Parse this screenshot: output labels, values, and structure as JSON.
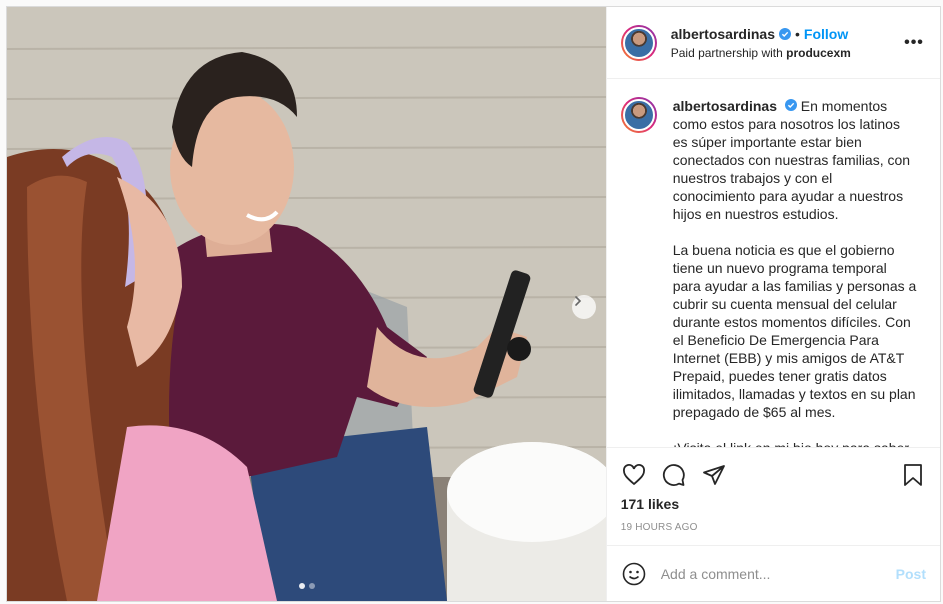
{
  "post": {
    "username": "albertosardinas",
    "follow_label": "Follow",
    "separator": "•",
    "partnership_prefix": "Paid partnership with",
    "partner": "producexm",
    "more_label": "•••"
  },
  "caption": {
    "username": "albertosardinas",
    "paragraph1": "En momentos como estos para nosotros los latinos es súper importante estar bien conectados con nuestras familias, con nuestros trabajos y con el conocimiento para ayudar a nuestros hijos en nuestros estudios.",
    "paragraph2": "La buena noticia es que el gobierno tiene un nuevo programa temporal para ayudar a las familias y personas a cubrir su cuenta mensual del celular durante estos momentos difíciles. Con el Beneficio De Emergencia Para Internet (EBB) y mis amigos de AT&T Prepaid, puedes tener gratis datos ilimitados, llamadas y textos en su plan prepagado de $65 al mes.",
    "paragraph3": "¡Visita el link en mi bio hoy para saber si eres elegible! @albertosardinas"
  },
  "stats": {
    "likes": "171 likes",
    "time": "19 HOURS AGO"
  },
  "comment": {
    "placeholder": "Add a comment...",
    "post_label": "Post"
  },
  "carousel": {
    "total": 2,
    "current": 1
  },
  "colors": {
    "follow": "#0095f6",
    "verified": "#3897f0",
    "post_disabled": "#b2dffc"
  },
  "icons": [
    "verified-badge-icon",
    "more-options-icon",
    "next-arrow-icon",
    "heart-icon",
    "comment-icon",
    "share-icon",
    "bookmark-icon",
    "emoji-icon"
  ]
}
